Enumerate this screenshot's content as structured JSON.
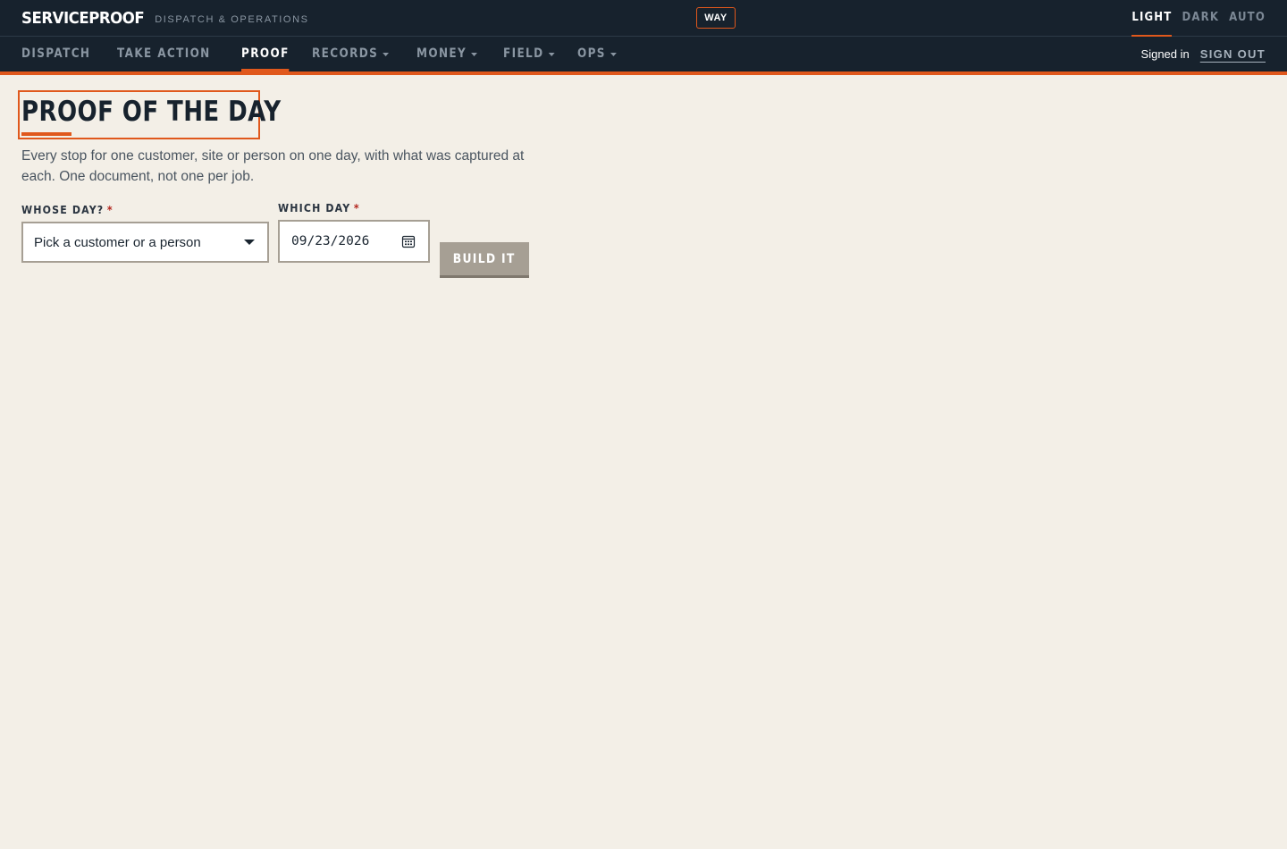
{
  "app": {
    "brand": "SERVICEPROOF",
    "tagline": "DISPATCH & OPERATIONS",
    "badge": "WAY"
  },
  "theme": {
    "options": [
      "LIGHT",
      "DARK",
      "AUTO"
    ],
    "selected": "LIGHT"
  },
  "nav": {
    "items": [
      {
        "label": "DISPATCH",
        "dropdown": false
      },
      {
        "label": "TAKE ACTION",
        "dropdown": false
      },
      {
        "label": "PROOF",
        "dropdown": false,
        "active": true
      },
      {
        "label": "RECORDS",
        "dropdown": true
      },
      {
        "label": "MONEY",
        "dropdown": true
      },
      {
        "label": "FIELD",
        "dropdown": true
      },
      {
        "label": "OPS",
        "dropdown": true
      }
    ],
    "status": "Signed in",
    "sign_out": "SIGN OUT"
  },
  "page": {
    "title": "PROOF OF THE DAY",
    "intro": "Every stop for one customer, site or person on one day, with what was captured at each. One document, not one per job."
  },
  "form": {
    "whose_label": "WHOSE DAY?",
    "whose_placeholder": "Pick a customer or a person",
    "which_label": "WHICH DAY",
    "required_mark": "*",
    "date_value": "09/23/2026",
    "submit_label": "BUILD IT"
  },
  "colors": {
    "accent": "#e0581c",
    "header_bg": "#17222d",
    "page_bg": "#f3efe7",
    "button_disabled": "#a69f94"
  },
  "icons": {
    "date_picker": "calendar-icon",
    "dropdown": "chevron-down-icon"
  }
}
